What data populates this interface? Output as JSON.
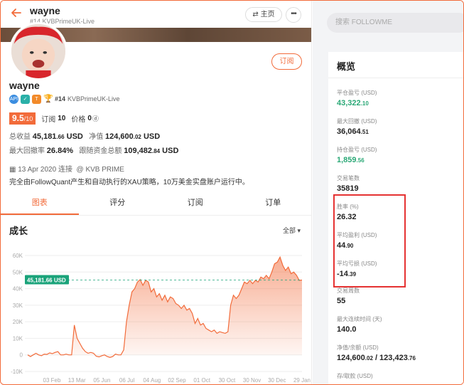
{
  "header": {
    "username": "wayne",
    "info": "#14  KVBPrimeUK-Live",
    "home_label": "⇄ 主页",
    "more_label": "•••"
  },
  "profile": {
    "username": "wayne",
    "subscribe_label": "订阅",
    "rank": "#14",
    "account": "KVBPrimeUK-Live",
    "badge_t": "T",
    "rating_main": "9.5",
    "rating_sub": "/10",
    "subs_label": "订阅",
    "subs_value": "10",
    "price_label": "价格",
    "price_value": "0",
    "total_profit_label": "总收益",
    "total_profit_main": "45,181",
    "total_profit_cents": ".66",
    "total_profit_unit": "USD",
    "equity_label": "净值",
    "equity_main": "124,600",
    "equity_cents": ".02",
    "equity_unit": "USD",
    "max_dd_label": "最大回撤率",
    "max_dd_value": "26.84%",
    "follow_funds_label": "跟随资金总额",
    "follow_funds_main": "109,482",
    "follow_funds_cents": ".84",
    "follow_funds_unit": "USD",
    "date_line": "13 Apr 2020 连接",
    "broker_line": "KVB PRIME",
    "description": "完全由FollowQuant产生和自动执行的XAU策略，10万美金实盘账户运行中。"
  },
  "tabs": [
    "图表",
    "评分",
    "订阅",
    "订单"
  ],
  "chart_section": {
    "title": "成长",
    "filter_label": "全部 ▾"
  },
  "chart_data": {
    "type": "area",
    "x": [
      "03 Feb",
      "13 Mar",
      "05 Jun",
      "06 Jul",
      "04 Aug",
      "02 Sep",
      "01 Oct",
      "30 Oct",
      "30 Nov",
      "30 Dec",
      "29 Jan"
    ],
    "y_ticks": [
      "60K",
      "50K",
      "40K",
      "30K",
      "20K",
      "10K",
      "0",
      "-10K"
    ],
    "ylim": [
      -10000,
      60000
    ],
    "current_label": "45,181.66 USD",
    "current_value": 45181.66,
    "series": [
      {
        "values": [
          0,
          -1000,
          0,
          1000,
          0,
          -500,
          500,
          300,
          1200,
          800,
          1500,
          2000,
          0,
          0,
          500,
          0,
          0,
          18000,
          10000,
          7000,
          4000,
          2000,
          1000,
          1500,
          1000,
          -800,
          -1200,
          -500,
          0,
          -1000,
          -1500,
          -1000,
          500,
          0,
          0,
          3000,
          20000,
          30000,
          38000,
          40000,
          44000,
          45500,
          42000,
          45000,
          44000,
          38000,
          40000,
          35000,
          37000,
          33000,
          36000,
          32000,
          35000,
          34000,
          31000,
          30000,
          28000,
          30000,
          27000,
          28000,
          25000,
          19000,
          22000,
          18000,
          19000,
          16000,
          15000,
          14000,
          15000,
          13000,
          14000,
          13500,
          13000,
          14000,
          30000,
          36000,
          34000,
          36000,
          40000,
          44000,
          43000,
          45000,
          43000,
          45000,
          44000,
          47000,
          46000,
          48000,
          46000,
          50000,
          55000,
          56000,
          59000,
          54000,
          51000,
          53000,
          49000,
          50000,
          48000,
          45000,
          45181.66
        ]
      }
    ],
    "colors": {
      "line": "#f26b3a",
      "label_bg": "#1aa37a"
    }
  },
  "right": {
    "search_placeholder": "搜索 FOLLOWME",
    "overview_title": "概览",
    "metrics": [
      {
        "label": "平仓盈亏 (USD)",
        "main": "43,322",
        "cents": ".10",
        "color": "green"
      },
      {
        "label": "最大回撤 (USD)",
        "main": "36,064",
        "cents": ".51",
        "color": ""
      },
      {
        "label": "持仓盈亏 (USD)",
        "main": "1,859",
        "cents": ".56",
        "color": "green"
      },
      {
        "label": "交易笔数",
        "main": "35819",
        "cents": "",
        "color": ""
      },
      {
        "label": "胜率 (%)",
        "main": "26.32",
        "cents": "",
        "color": ""
      },
      {
        "label": "平均盈利 (USD)",
        "main": "44",
        "cents": ".90",
        "color": ""
      },
      {
        "label": "平均亏损 (USD)",
        "main": "-14",
        "cents": ".39",
        "color": ""
      },
      {
        "label": "交易周数",
        "main": "55",
        "cents": "",
        "color": ""
      },
      {
        "label": "最大连续时间 (天)",
        "main": "140.0",
        "cents": "",
        "color": ""
      },
      {
        "label": "净值/余额 (USD)",
        "main": "124,600",
        "cents": ".02",
        "suffix_main": " / 123,423",
        "suffix_cents": ".76",
        "color": ""
      },
      {
        "label": "存/取款 (USD)",
        "main": "",
        "cents": "",
        "color": ""
      }
    ]
  },
  "colors": {
    "accent": "#f26b3a",
    "green": "#2aa876",
    "highlight": "#e53232"
  }
}
